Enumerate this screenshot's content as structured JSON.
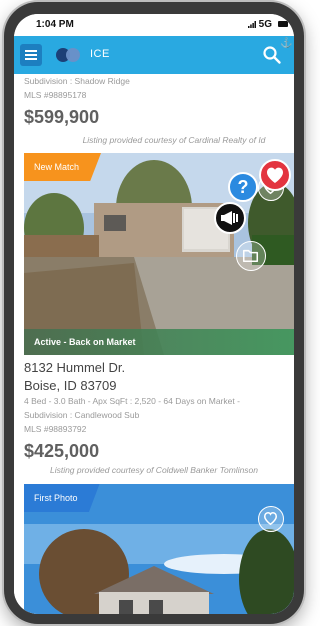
{
  "status_bar": {
    "time": "1:04 PM",
    "network": "5G"
  },
  "app_bar": {
    "brand": "ICE"
  },
  "listings": [
    {
      "subdivision": "Subdivision : Shadow Ridge",
      "mls": "MLS #98895178",
      "price": "$599,900",
      "courtesy": "Listing provided courtesy of Cardinal Realty of Id"
    },
    {
      "badge": "New Match",
      "status": "Active - Back on Market",
      "street": "8132 Hummel Dr.",
      "city": "Boise, ID 83709",
      "details": "4  Bed - 3.0  Bath - Apx SqFt : 2,520 - 64 Days on Market -",
      "subdivision": "Subdivision : Candlewood Sub",
      "mls": "MLS #98893792",
      "price": "$425,000",
      "courtesy": "Listing provided courtesy of Coldwell Banker Tomlinson"
    },
    {
      "badge": "First Photo"
    }
  ],
  "fab": {
    "help_glyph": "?"
  },
  "colors": {
    "appbar": "#29a9e1",
    "new_match": "#f7931d",
    "first_photo": "#2b7bd6",
    "heart": "#e3343f",
    "help": "#2b8ae0"
  },
  "icons": [
    "menu-icon",
    "search-icon",
    "heart-icon",
    "help-icon",
    "megaphone-icon",
    "folder-icon",
    "favorite-heart-icon",
    "logo-icon"
  ]
}
